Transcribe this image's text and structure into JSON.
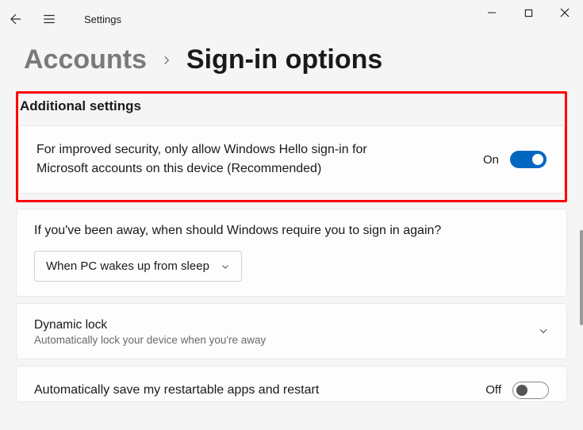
{
  "window": {
    "title": "Settings"
  },
  "breadcrumb": {
    "parent": "Accounts",
    "current": "Sign-in options"
  },
  "section_header": "Additional settings",
  "hello_card": {
    "text": "For improved security, only allow Windows Hello sign-in for Microsoft accounts on this device (Recommended)",
    "state_label": "On"
  },
  "away_card": {
    "question": "If you've been away, when should Windows require you to sign in again?",
    "dropdown_value": "When PC wakes up from sleep"
  },
  "dynamic_lock": {
    "title": "Dynamic lock",
    "subtitle": "Automatically lock your device when you're away"
  },
  "restart_card": {
    "title": "Automatically save my restartable apps and restart",
    "state_label": "Off"
  }
}
